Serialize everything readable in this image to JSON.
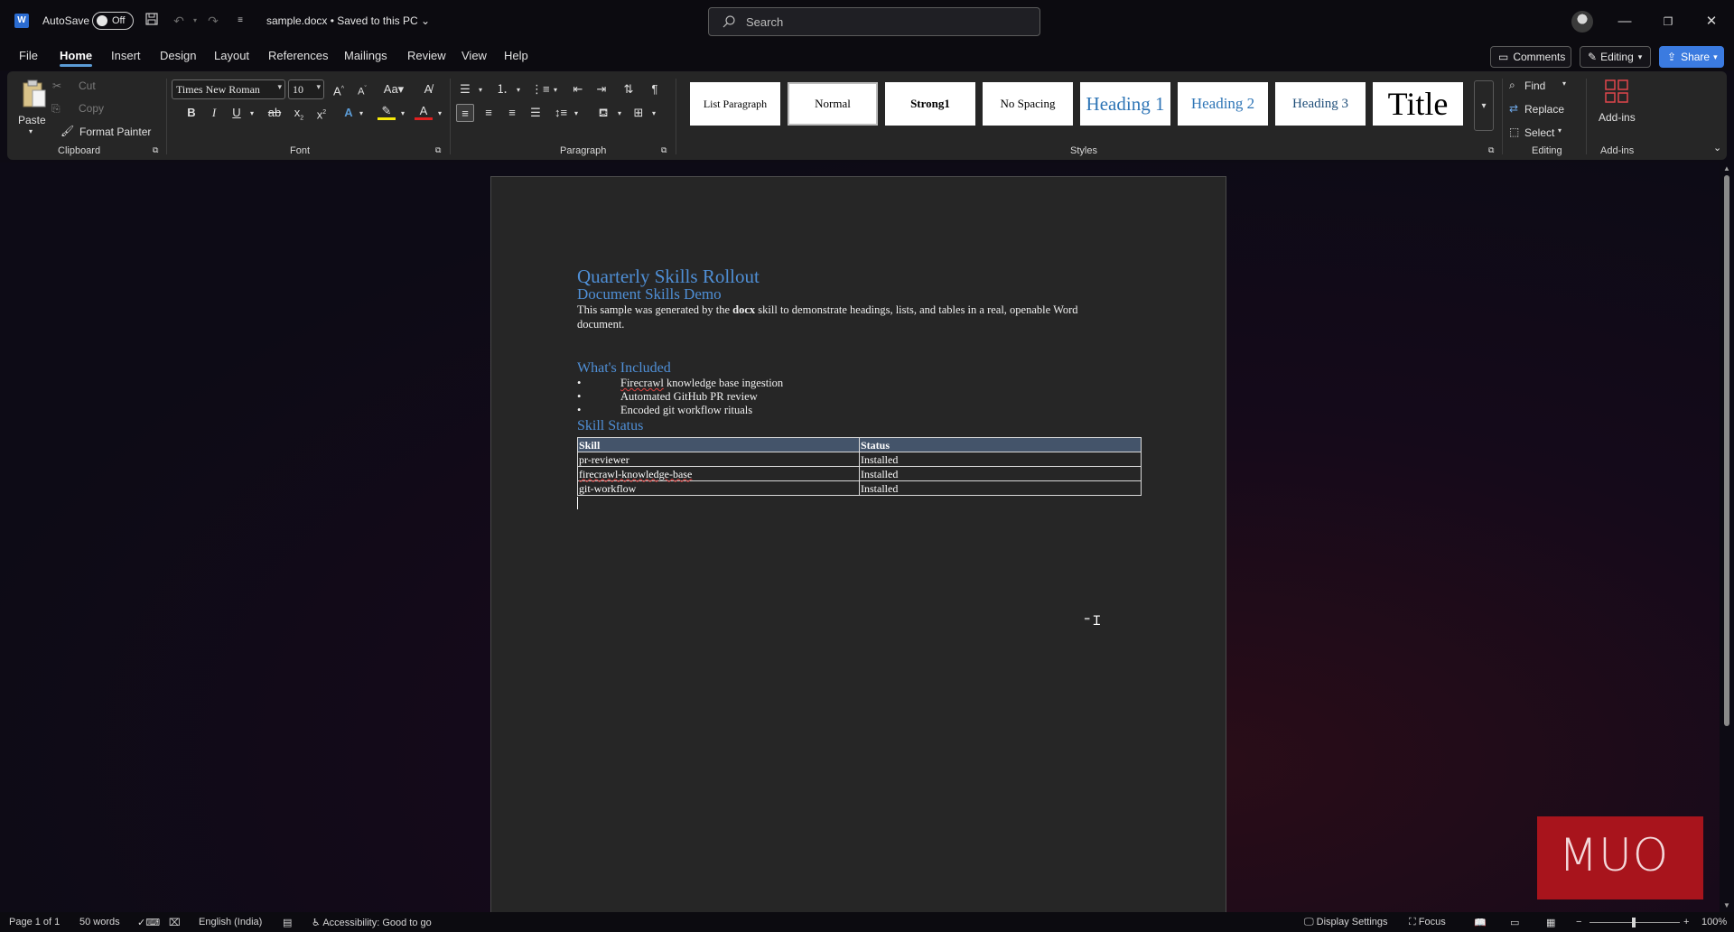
{
  "titlebar": {
    "autosave_label": "AutoSave",
    "autosave_state": "Off",
    "doc_title": "sample.docx • Saved to this PC",
    "search_placeholder": "Search"
  },
  "menu": {
    "tabs": [
      "File",
      "Home",
      "Insert",
      "Design",
      "Layout",
      "References",
      "Mailings",
      "Review",
      "View",
      "Help"
    ],
    "active_tab": "Home",
    "comments_label": "Comments",
    "editing_label": "Editing",
    "share_label": "Share"
  },
  "ribbon": {
    "clipboard": {
      "paste": "Paste",
      "cut": "Cut",
      "copy": "Copy",
      "format_painter": "Format Painter",
      "label": "Clipboard"
    },
    "font": {
      "name": "Times New Roman",
      "size": "10",
      "label": "Font"
    },
    "paragraph": {
      "label": "Paragraph"
    },
    "styles": {
      "label": "Styles",
      "items": [
        "List Paragraph",
        "Normal",
        "Strong1",
        "No Spacing",
        "Heading 1",
        "Heading 2",
        "Heading 3",
        "Title"
      ],
      "selected": "Normal"
    },
    "editing": {
      "find": "Find",
      "replace": "Replace",
      "select": "Select",
      "label": "Editing"
    },
    "addins": {
      "button": "Add-ins",
      "label": "Add-ins"
    }
  },
  "document": {
    "title": "Quarterly Skills Rollout",
    "subtitle": "Document Skills Demo",
    "para_before": "This sample was generated by the ",
    "para_bold": "docx",
    "para_after": " skill to demonstrate headings, lists, and tables in a real, openable Word document.",
    "section1_heading": "What's Included",
    "bullets": [
      "knowledge base ingestion",
      "Automated GitHub PR review",
      "Encoded git workflow rituals"
    ],
    "bullet1_misspelled": "Firecrawl",
    "section2_heading": "Skill Status",
    "table": {
      "headers": [
        "Skill",
        "Status"
      ],
      "rows": [
        [
          "pr-reviewer",
          "Installed"
        ],
        [
          "firecrawl-knowledge-base",
          "Installed"
        ],
        [
          "git-workflow",
          "Installed"
        ]
      ]
    }
  },
  "statusbar": {
    "page": "Page 1 of 1",
    "words": "50 words",
    "language": "English (India)",
    "accessibility": "Accessibility: Good to go",
    "display_settings": "Display Settings",
    "focus": "Focus",
    "zoom": "100%"
  },
  "watermark": {
    "text": "MUO"
  },
  "colors": {
    "accent": "#5b9bd5",
    "heading": "#4f8fd6",
    "share": "#3b7be0",
    "table_header": "#44546a"
  }
}
